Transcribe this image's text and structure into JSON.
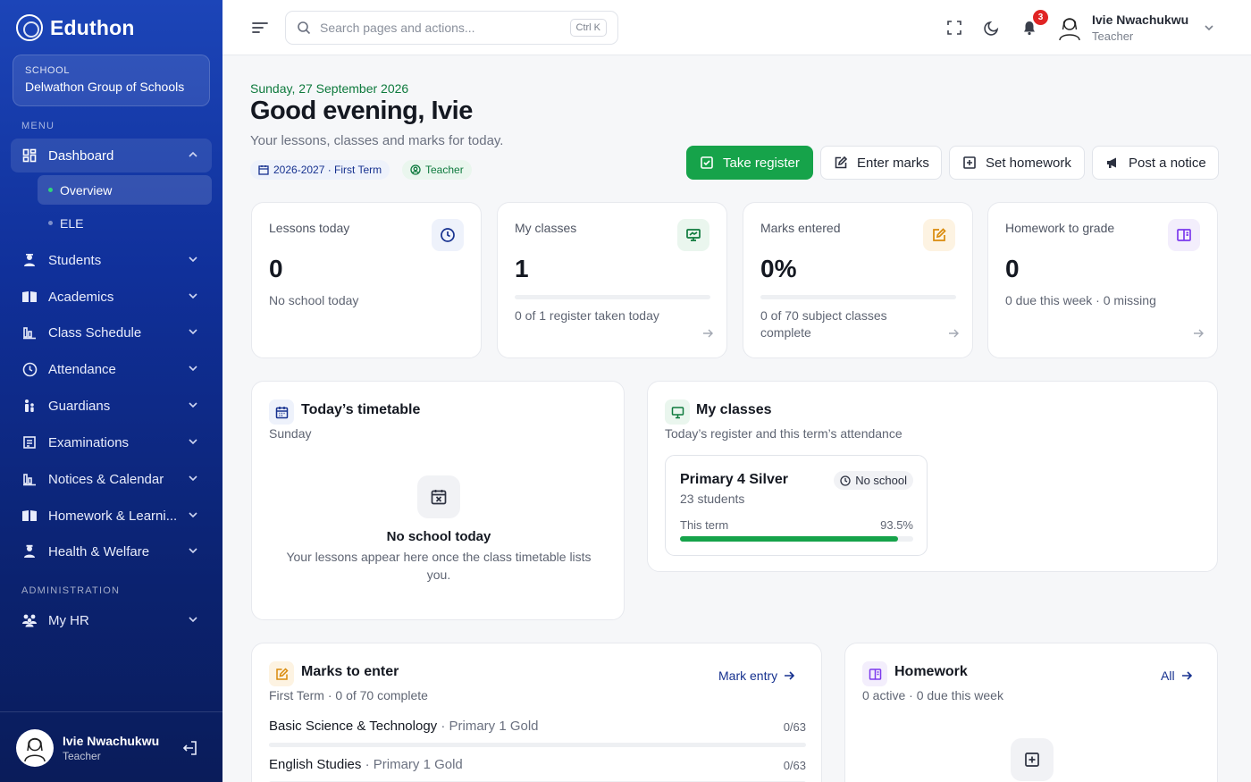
{
  "brand": {
    "name": "Eduthon"
  },
  "school": {
    "label": "SCHOOL",
    "name": "Delwathon Group of Schools"
  },
  "sidebar": {
    "menu_label": "MENU",
    "admin_label": "ADMINISTRATION",
    "dashboard": {
      "label": "Dashboard",
      "subitems": [
        "Overview",
        "ELE"
      ]
    },
    "items": [
      {
        "label": "Students",
        "icon": "student-icon"
      },
      {
        "label": "Academics",
        "icon": "book-icon"
      },
      {
        "label": "Class Schedule",
        "icon": "chart-icon"
      },
      {
        "label": "Attendance",
        "icon": "clock-icon"
      },
      {
        "label": "Guardians",
        "icon": "family-icon"
      },
      {
        "label": "Examinations",
        "icon": "exam-icon"
      },
      {
        "label": "Notices & Calendar",
        "icon": "chart-icon"
      },
      {
        "label": "Homework & Learni...",
        "icon": "book-icon"
      },
      {
        "label": "Health & Welfare",
        "icon": "nurse-icon"
      }
    ],
    "admin_items": [
      {
        "label": "My HR",
        "icon": "people-icon"
      }
    ],
    "user": {
      "name": "Ivie Nwachukwu",
      "role": "Teacher"
    }
  },
  "topbar": {
    "search_placeholder": "Search pages and actions...",
    "shortcut": "Ctrl K",
    "notifications": "3",
    "user": {
      "name": "Ivie Nwachukwu",
      "role": "Teacher"
    }
  },
  "header": {
    "date": "Sunday, 27 September 2026",
    "greeting": "Good evening, Ivie",
    "subtitle": "Your lessons, classes and marks for today.",
    "term_chip": "2026-2027 · First Term",
    "role_chip": "Teacher"
  },
  "actions": {
    "take_register": "Take register",
    "enter_marks": "Enter marks",
    "set_homework": "Set homework",
    "post_notice": "Post a notice"
  },
  "stats": [
    {
      "title": "Lessons today",
      "value": "0",
      "note": "No school today"
    },
    {
      "title": "My classes",
      "value": "1",
      "progress": 0,
      "note": "0 of 1 register taken today"
    },
    {
      "title": "Marks entered",
      "value": "0%",
      "progress": 0,
      "note": "0 of 70 subject classes complete"
    },
    {
      "title": "Homework to grade",
      "value": "0",
      "note": "0 due this week · 0 missing"
    }
  ],
  "timetable": {
    "title": "Today’s timetable",
    "day": "Sunday",
    "empty_title": "No school today",
    "empty_text": "Your lessons appear here once the class timetable lists you."
  },
  "my_classes": {
    "title": "My classes",
    "subtitle": "Today’s register and this term’s attendance",
    "class_name": "Primary 4 Silver",
    "students": "23 students",
    "status": "No school",
    "term_label": "This term",
    "term_pct": "93.5%",
    "term_value": 93.5
  },
  "marks": {
    "title": "Marks to enter",
    "subtitle": "First Term · 0 of 70 complete",
    "link": "Mark entry",
    "rows": [
      {
        "subject": "Basic Science & Technology",
        "class": " · Primary 1 Gold",
        "count": "0/63"
      },
      {
        "subject": "English Studies",
        "class": " · Primary 1 Gold",
        "count": "0/63"
      }
    ]
  },
  "homework": {
    "title": "Homework",
    "subtitle": "0 active · 0 due this week",
    "link": "All"
  },
  "colors": {
    "primary": "#16a34a",
    "sidebar": "#10309a",
    "link": "#16318f",
    "badge": "#e02424"
  }
}
